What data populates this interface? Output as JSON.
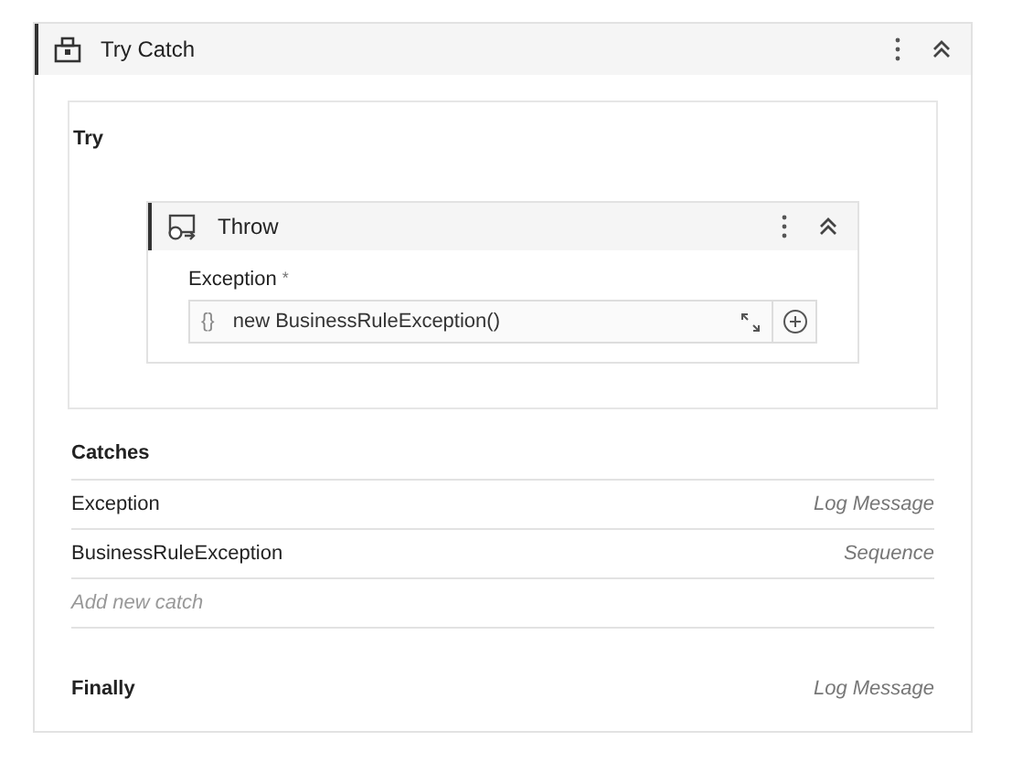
{
  "activity": {
    "title": "Try Catch"
  },
  "try": {
    "label": "Try",
    "child": {
      "title": "Throw",
      "field_label": "Exception",
      "required_mark": "*",
      "field_prefix": "{}",
      "field_value": "new BusinessRuleException()"
    }
  },
  "catches": {
    "label": "Catches",
    "rows": [
      {
        "exception": "Exception",
        "action": "Log Message"
      },
      {
        "exception": "BusinessRuleException",
        "action": "Sequence"
      }
    ],
    "add_link": "Add new catch"
  },
  "finally": {
    "label": "Finally",
    "action": "Log Message"
  }
}
